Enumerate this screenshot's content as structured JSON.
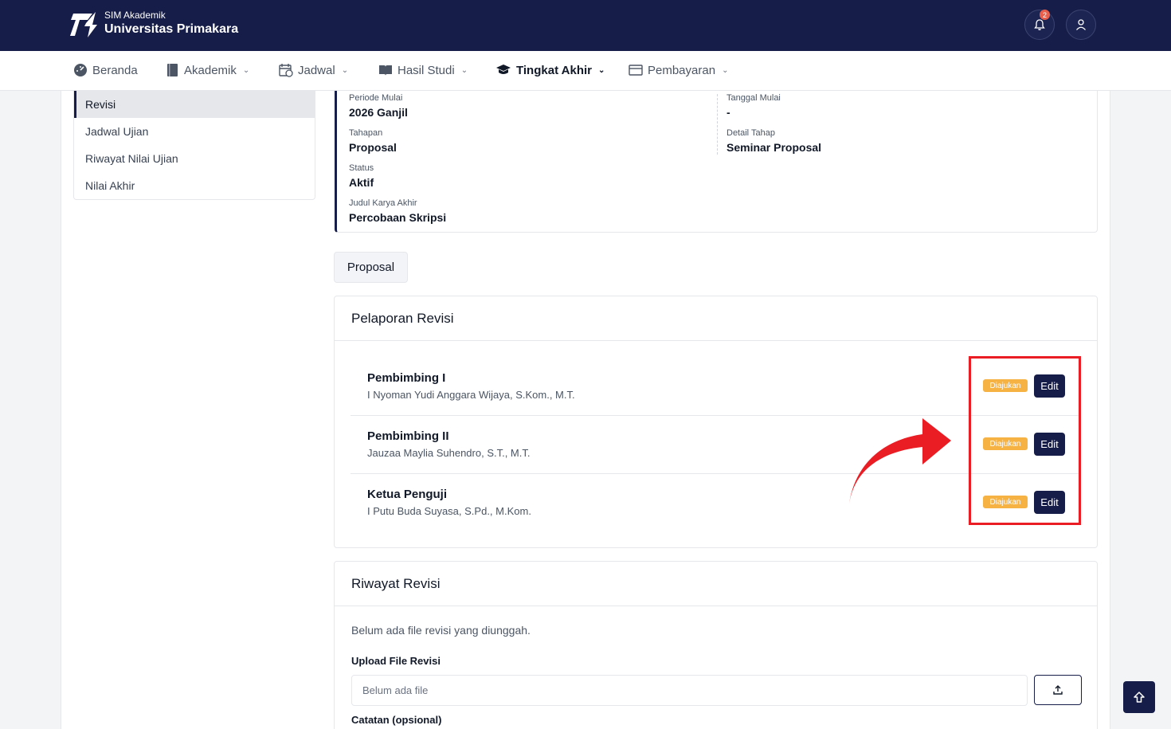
{
  "header": {
    "brand_sub": "SIM Akademik",
    "brand_main": "Universitas Primakara",
    "notification_count": "2"
  },
  "nav": {
    "items": [
      {
        "label": "Beranda",
        "icon": "dashboard-icon"
      },
      {
        "label": "Akademik",
        "icon": "book-icon"
      },
      {
        "label": "Jadwal",
        "icon": "calendar-icon"
      },
      {
        "label": "Hasil Studi",
        "icon": "open-book-icon"
      },
      {
        "label": "Tingkat Akhir",
        "icon": "graduation-cap-icon",
        "active": true
      },
      {
        "label": "Pembayaran",
        "icon": "wallet-icon"
      }
    ]
  },
  "sidebar": {
    "items": [
      {
        "label": "Revisi",
        "active": true
      },
      {
        "label": "Jadwal Ujian"
      },
      {
        "label": "Riwayat Nilai Ujian"
      },
      {
        "label": "Nilai Akhir"
      }
    ]
  },
  "info": {
    "periode_label": "Periode Mulai",
    "periode_value": "2026 Ganjil",
    "tanggal_label": "Tanggal Mulai",
    "tanggal_value": "-",
    "tahapan_label": "Tahapan",
    "tahapan_value": "Proposal",
    "detail_label": "Detail Tahap",
    "detail_value": "Seminar Proposal",
    "status_label": "Status",
    "status_value": "Aktif",
    "judul_label": "Judul Karya Akhir",
    "judul_value": "Percobaan Skripsi"
  },
  "tab": {
    "label": "Proposal"
  },
  "pelaporan": {
    "title": "Pelaporan Revisi",
    "rows": [
      {
        "role": "Pembimbing I",
        "name": "I Nyoman Yudi Anggara Wijaya, S.Kom., M.T.",
        "status": "Diajukan",
        "action": "Edit"
      },
      {
        "role": "Pembimbing II",
        "name": "Jauzaa Maylia Suhendro, S.T., M.T.",
        "status": "Diajukan",
        "action": "Edit"
      },
      {
        "role": "Ketua Penguji",
        "name": "I Putu Buda Suyasa, S.Pd., M.Kom.",
        "status": "Diajukan",
        "action": "Edit"
      }
    ]
  },
  "riwayat": {
    "title": "Riwayat Revisi",
    "empty_text": "Belum ada file revisi yang diunggah.",
    "upload_label": "Upload File Revisi",
    "file_placeholder": "Belum ada file",
    "catatan_label": "Catatan (opsional)"
  },
  "colors": {
    "primary": "#161d48",
    "badge": "#f6b343",
    "highlight": "#ea1d24",
    "notification": "#e8604c"
  }
}
